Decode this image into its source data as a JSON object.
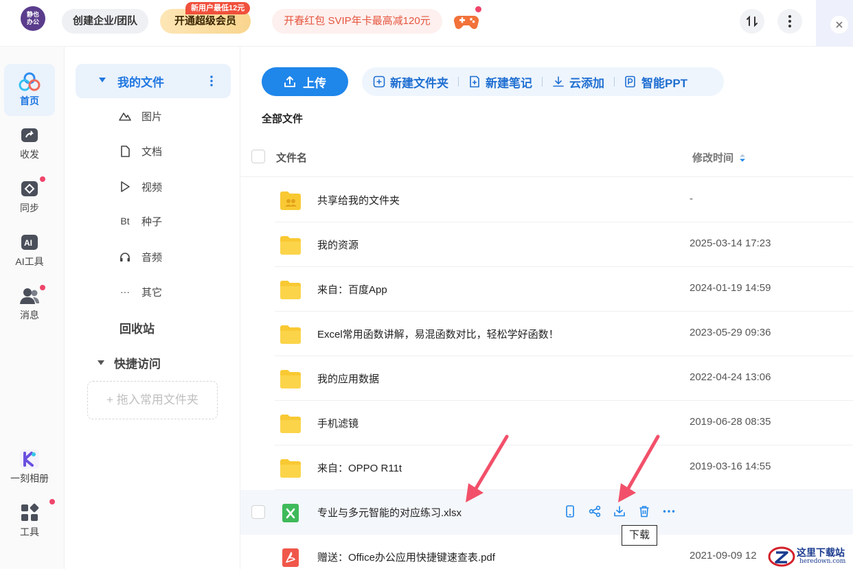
{
  "topbar": {
    "logo_text": "静也办公",
    "team_label": "创建企业/团队",
    "vip_label": "开通超级会员",
    "vip_badge": "新用户最低12元",
    "promo_label": "开春红包 SVIP年卡最高减120元"
  },
  "rail": {
    "items": [
      {
        "label": "首页",
        "icon": "home-cloud-icon"
      },
      {
        "label": "收发",
        "icon": "share-folder-icon"
      },
      {
        "label": "同步",
        "icon": "sync-icon"
      },
      {
        "label": "AI工具",
        "icon": "ai-icon"
      },
      {
        "label": "消息",
        "icon": "users-icon"
      },
      {
        "label": "一刻相册",
        "icon": "album-icon"
      },
      {
        "label": "工具",
        "icon": "tools-icon"
      }
    ]
  },
  "nav": {
    "my_files": "我的文件",
    "categories": [
      {
        "label": "图片",
        "glyph": "⛰"
      },
      {
        "label": "文档",
        "glyph": "▯"
      },
      {
        "label": "视频",
        "glyph": "▷"
      },
      {
        "label": "种子",
        "glyph": "Bt"
      },
      {
        "label": "音频",
        "glyph": "∩"
      },
      {
        "label": "其它",
        "glyph": "···"
      }
    ],
    "recycle": "回收站",
    "quick_access": "快捷访问",
    "drop_hint": "+ 拖入常用文件夹"
  },
  "main": {
    "upload": "上传",
    "toolbar": [
      "新建文件夹",
      "新建笔记",
      "云添加",
      "智能PPT"
    ],
    "breadcrumb": "全部文件",
    "col_name": "文件名",
    "col_time": "修改时间",
    "rows": [
      {
        "name": "共享给我的文件夹",
        "time": "-",
        "type": "shared-folder"
      },
      {
        "name": "我的资源",
        "time": "2025-03-14 17:23",
        "type": "folder"
      },
      {
        "name": "来自：百度App",
        "time": "2024-01-19 14:59",
        "type": "folder"
      },
      {
        "name": "Excel常用函数讲解，易混函数对比，轻松学好函数！",
        "time": "2023-05-29 09:36",
        "type": "folder"
      },
      {
        "name": "我的应用数据",
        "time": "2022-04-24 13:06",
        "type": "folder"
      },
      {
        "name": "手机滤镜",
        "time": "2019-06-28 08:35",
        "type": "folder"
      },
      {
        "name": "来自：OPPO R11t",
        "time": "2019-03-16 14:55",
        "type": "folder"
      },
      {
        "name": "专业与多元智能的对应练习.xlsx",
        "time": "",
        "type": "xlsx"
      },
      {
        "name": "赠送：Office办公应用快捷键速查表.pdf",
        "time": "2021-09-09 12",
        "type": "pdf"
      }
    ],
    "tooltip": "下载"
  },
  "watermark": {
    "title": "这里下载站",
    "sub": "heredown.com"
  },
  "colors": {
    "accent": "#1f86ea",
    "folder": "#f9c933",
    "badge": "#f0503c"
  }
}
